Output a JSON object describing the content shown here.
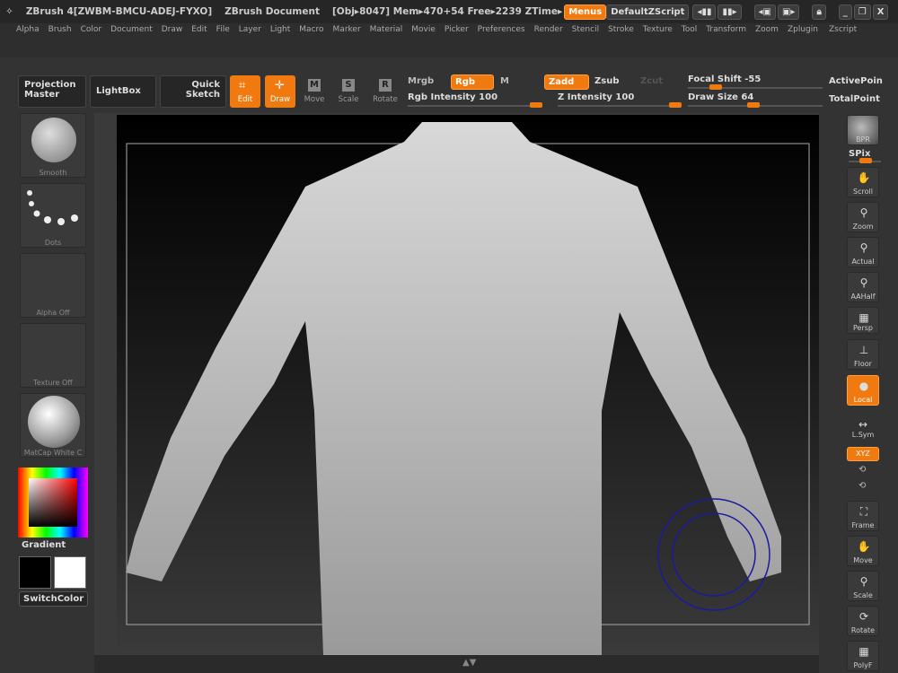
{
  "title": {
    "app": "ZBrush 4[ZWBM-BMCU-ADEJ-FYXO]",
    "document": "ZBrush Document",
    "stats": "[Obj▸8047] Mem▸470+54 Free▸2239 ZTime▸",
    "menus": "Menus",
    "script": "DefaultZScript"
  },
  "menu": [
    "Alpha",
    "Brush",
    "Color",
    "Document",
    "Draw",
    "Edit",
    "File",
    "Layer",
    "Light",
    "Macro",
    "Marker",
    "Material",
    "Movie",
    "Picker",
    "Preferences",
    "Render",
    "Stencil",
    "Stroke",
    "Texture",
    "Tool",
    "Transform",
    "Zoom",
    "Zplugin",
    "Zscript"
  ],
  "toolbar": {
    "projection": "Projection",
    "master": "Master",
    "lightbox": "LightBox",
    "quick": "Quick",
    "sketch": "Sketch",
    "edit": "Edit",
    "draw": "Draw",
    "move": "Move",
    "scale": "Scale",
    "rotate": "Rotate",
    "mrgb": "Mrgb",
    "rgb": "Rgb",
    "m": "M",
    "zadd": "Zadd",
    "zsub": "Zsub",
    "zcut": "Zcut",
    "rgb_intensity": "Rgb  Intensity 100",
    "z_intensity": "Z  Intensity 100",
    "focal_shift": "Focal  Shift -55",
    "draw_size": "Draw  Size 64",
    "active_points": "ActivePoin",
    "total_points": "TotalPoint",
    "rgb_intensity_value": 100,
    "z_intensity_value": 100,
    "focal_shift_value": -55,
    "draw_size_value": 64
  },
  "left": {
    "brush": "Smooth",
    "stroke": "Dots",
    "alpha": "Alpha  Off",
    "texture": "Texture  Off",
    "material": "MatCap  White  C",
    "gradient": "Gradient",
    "switch": "SwitchColor"
  },
  "right": [
    "BPR",
    "SPix",
    "Scroll",
    "Zoom",
    "Actual",
    "AAHalf",
    "Persp",
    "Floor",
    "Local",
    "L.Sym",
    "XYZ",
    "Frame",
    "Move",
    "Scale",
    "Rotate",
    "PolyF"
  ],
  "colors": {
    "accent": "#f07a10",
    "main": "#000000",
    "secondary": "#ffffff"
  }
}
